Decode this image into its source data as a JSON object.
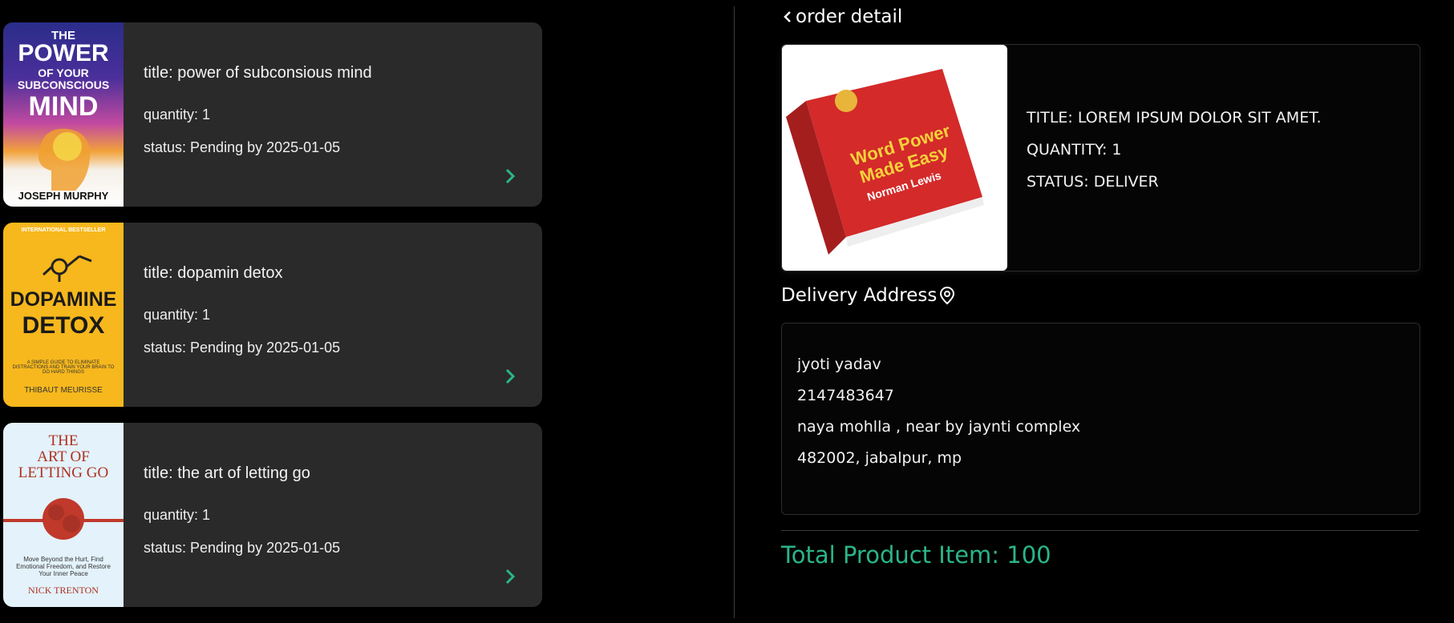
{
  "orders": [
    {
      "title": "title: power of subconsious mind",
      "quantity": "quantity: 1",
      "status": "status: Pending by 2025-01-05",
      "cover": {
        "line1": "THE",
        "line2": "POWER",
        "line3": "OF YOUR",
        "line4": "SUBCONSCIOUS",
        "line5": "MIND",
        "author": "JOSEPH MURPHY"
      }
    },
    {
      "title": "title: dopamin detox",
      "quantity": "quantity: 1",
      "status": "status: Pending by 2025-01-05",
      "cover": {
        "tag": "INTERNATIONAL BESTSELLER",
        "line1": "DOPAMINE",
        "line2": "DETOX",
        "subtitle": "A SIMPLE GUIDE TO ELIMINATE DISTRACTIONS AND TRAIN YOUR BRAIN TO DO HARD THINGS",
        "author": "THIBAUT MEURISSE"
      }
    },
    {
      "title": "title: the art of letting go",
      "quantity": "quantity: 1",
      "status": "status: Pending by 2025-01-05",
      "cover": {
        "line1": "THE",
        "line2": "ART OF",
        "line3": "LETTING GO",
        "subtitle": "Move Beyond the Hurt, Find Emotional Freedom, and Restore Your Inner Peace",
        "author": "NICK TRENTON"
      }
    }
  ],
  "detail": {
    "back_label": "order detail",
    "product": {
      "title": "TITLE: LOREM IPSUM DOLOR SIT AMET.",
      "quantity": "QUANTITY: 1",
      "status": "STATUS: DELIVER",
      "cover": {
        "line1": "Word Power",
        "line2": "Made Easy",
        "author": "Norman Lewis"
      }
    },
    "address_heading": "Delivery Address",
    "address": {
      "name": "jyoti yadav",
      "phone": "2147483647",
      "street": "naya mohlla , near by jaynti complex",
      "city": "482002, jabalpur, mp"
    },
    "total": "Total Product Item: 100"
  },
  "colors": {
    "accent": "#2ab589",
    "card": "#2a2a2a",
    "background": "#000000"
  },
  "icons": {
    "chevron": "chevron-right-icon",
    "back": "chevron-left-icon",
    "location": "location-pin-icon"
  }
}
